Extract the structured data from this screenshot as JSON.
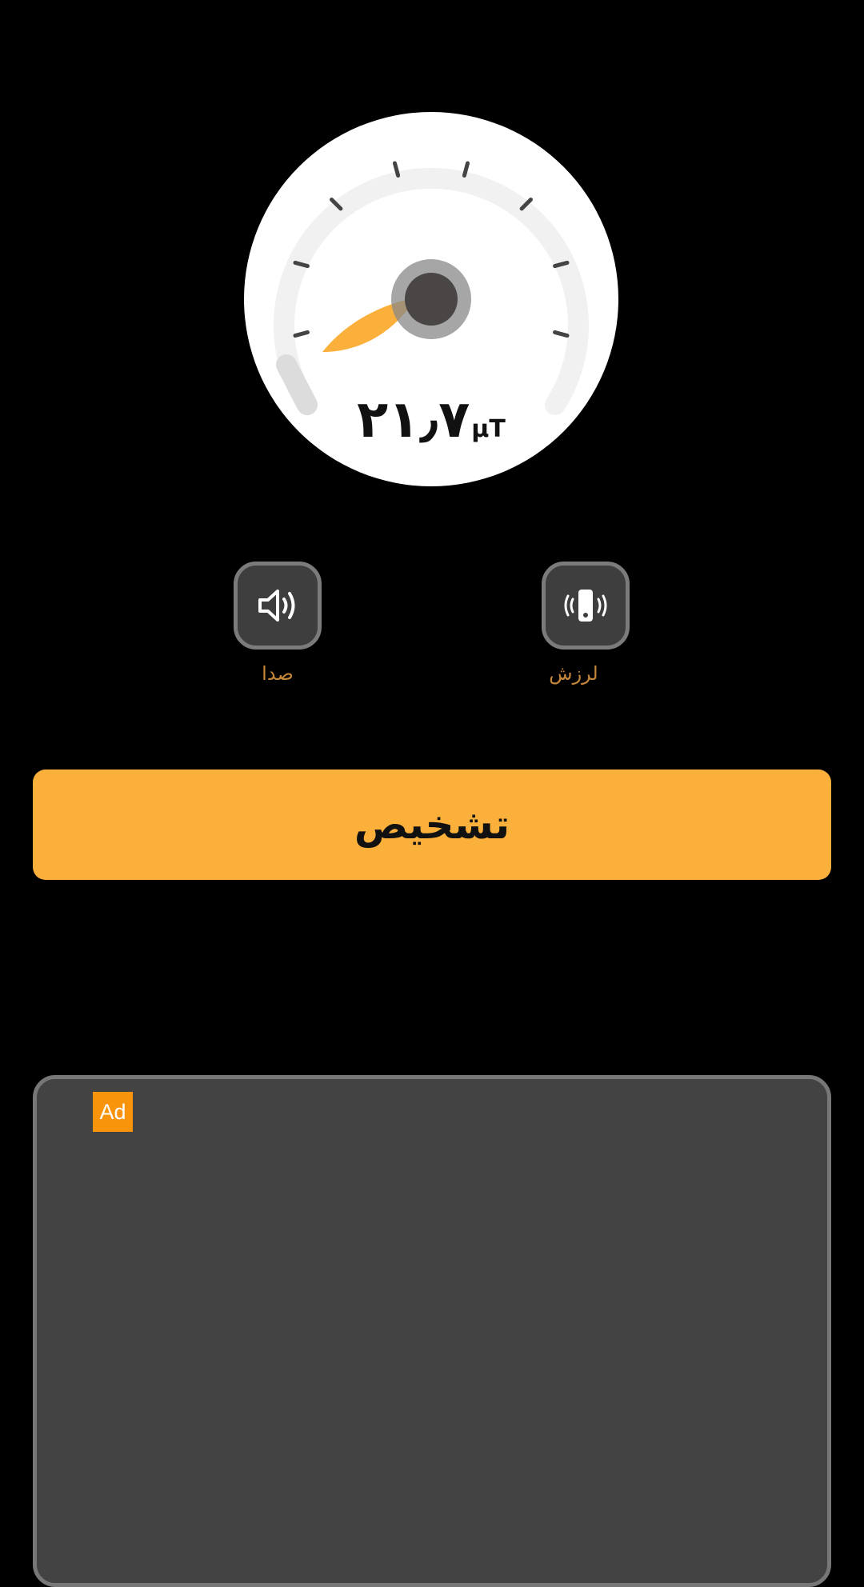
{
  "gauge": {
    "value_text": "۲۱٫۷",
    "unit": "μT",
    "level_fraction": 0.07,
    "needle_color": "#fbb03b"
  },
  "controls": {
    "sound": {
      "label": "صدا",
      "icon": "speaker-icon"
    },
    "vibration": {
      "label": "لرزش",
      "icon": "vibration-icon"
    }
  },
  "detect_button": {
    "label": "تشخیص"
  },
  "ad": {
    "badge": "Ad"
  },
  "colors": {
    "accent": "#fbb03b",
    "background": "#000000",
    "control_bg": "#3e3e3e",
    "label": "#c5863a",
    "ad_badge": "#f7940c"
  }
}
